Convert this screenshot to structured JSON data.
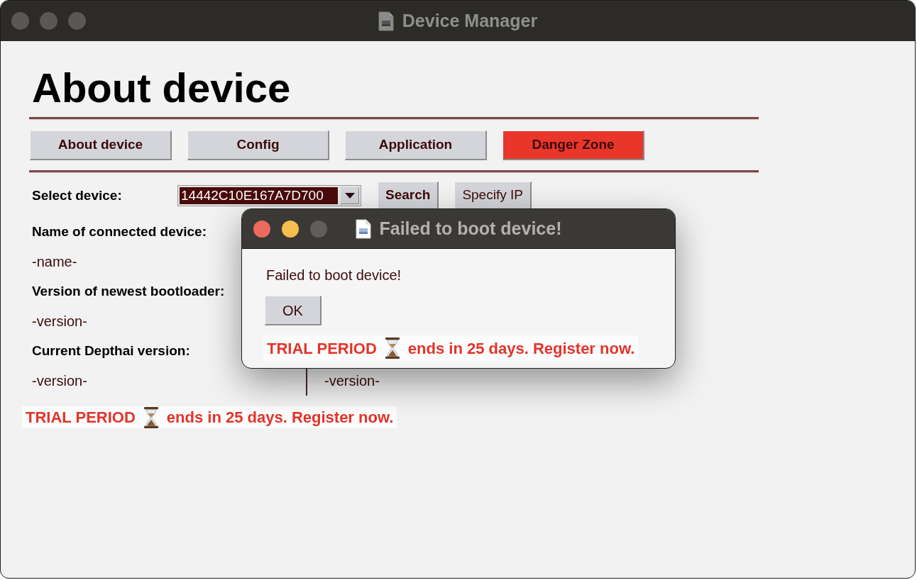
{
  "window": {
    "title": "Device Manager"
  },
  "page": {
    "heading": "About device"
  },
  "tabs": [
    {
      "label": "About device",
      "selected": false
    },
    {
      "label": "Config",
      "selected": false
    },
    {
      "label": "Application",
      "selected": false
    },
    {
      "label": "Danger Zone",
      "selected": true
    }
  ],
  "device_select": {
    "label": "Select device:",
    "value": "14442C10E167A7D700",
    "buttons": [
      {
        "label": "Search",
        "default": true
      },
      {
        "label": "Specify IP",
        "default": false
      }
    ]
  },
  "info": {
    "left": [
      {
        "kind": "label",
        "text": "Name of connected device:"
      },
      {
        "kind": "value",
        "text": "-name-"
      },
      {
        "kind": "label",
        "text": "Version of newest bootloader:"
      },
      {
        "kind": "value",
        "text": "-version-"
      },
      {
        "kind": "label",
        "text": "Current Depthai version:"
      },
      {
        "kind": "value",
        "text": "-version-"
      }
    ],
    "right": [
      {
        "kind": "value",
        "text": "-version-"
      }
    ]
  },
  "trial_banner": {
    "lead": "TRIAL PERIOD",
    "rest": "ends in 25 days. Register now."
  },
  "dialog": {
    "title": "Failed to boot device!",
    "message": "Failed to boot device!",
    "button": "OK",
    "trial_banner": {
      "lead": "TRIAL PERIOD",
      "rest": "ends in 25 days. Register now."
    }
  }
}
